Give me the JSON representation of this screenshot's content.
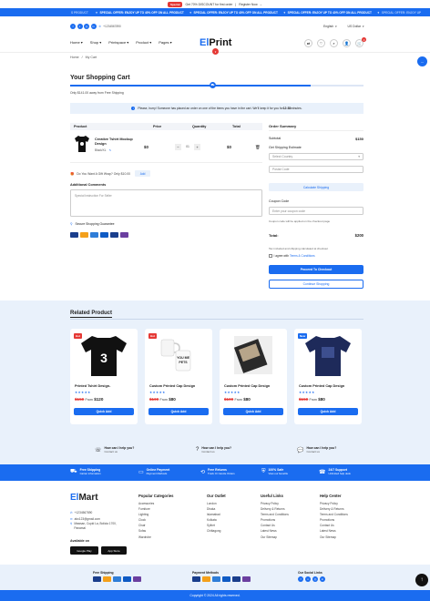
{
  "topbar": {
    "pill": "Special",
    "text": "Get 70% DISCOUNT for first order",
    "link": "Register Now"
  },
  "promo": {
    "items": [
      "SPECIAL OFFER: ENJOY UP TO 40% OFF ON ALL PRODUCT",
      "SPECIAL OFFER: ENJOY UP TO 40% OFF ON ALL PRODUCT",
      "SPECIAL OFFER: ENJOY UP TO 40% OFF ON ALL PRODUCT"
    ],
    "left_fragment": "S PRODUCT",
    "right_fragment": "SPECIAL OFFER: ENJOY UP"
  },
  "utility": {
    "phone": "+1234567890",
    "language": "English",
    "currency": "US Dollar"
  },
  "nav": {
    "items": [
      "Home",
      "Shop",
      "Printspace",
      "Product",
      "Pages"
    ],
    "logo_a": "El",
    "logo_b": "Print",
    "cart_count": "0"
  },
  "breadcrumb": {
    "home": "Home",
    "current": "My Cart"
  },
  "cart": {
    "title": "Your Shopping Cart",
    "shipping_progress": "Only $141.00 away from Free Shipping",
    "progress_pct": 82,
    "notice_pre": "Please, hurry! Someone has placed an order on one of the items you have in the cart. We'll keep it for you for ",
    "notice_time": "12:38",
    "notice_post": " minutes.",
    "columns": [
      "Product",
      "Price",
      "Quantity",
      "Total"
    ],
    "item": {
      "name": "Creative Tshirt Mockup Design",
      "variant": "Black/XL",
      "price": "$0",
      "qty": "01",
      "total": "$0"
    },
    "gift_text": "Do You Want A Gift Wrap? Only $10.00",
    "gift_btn": "Add",
    "comments_label": "Additional Comments",
    "comments_placeholder": "Special Instruction For Seller",
    "secure": "Secure Shopping Guarantee"
  },
  "summary": {
    "title": "Order Summary",
    "subtotal_label": "Subtotal",
    "subtotal": "$150",
    "shipping_label": "Get Shipping Estimate",
    "country": "Select Country",
    "postal": "Postal Code",
    "calc_btn": "Calculate Shipping",
    "coupon_label": "Coupon Code",
    "coupon_placeholder": "Enter your coupon code",
    "coupon_note": "Coupon code will be applied on the checkout page",
    "total_label": "Total:",
    "total": "$200",
    "tax_note": "Tax included and shipping calculated at checkout",
    "agree_pre": "I agree with ",
    "agree_link": "Terms & Conditions",
    "checkout_btn": "Proceed To Checkout",
    "continue_btn": "Continue Shopping"
  },
  "related": {
    "title": "Related Product",
    "products": [
      {
        "badge": "Hot",
        "name": "Printed Tshirt Design-",
        "old": "$150",
        "from": "From",
        "price": "$120",
        "btn": "Quick Add"
      },
      {
        "badge": "Hot",
        "name": "Custom Printed Cap Design",
        "old": "$100",
        "from": "From",
        "price": "$80",
        "btn": "Quick Add"
      },
      {
        "badge": "",
        "name": "Custom Printed Cap Design",
        "old": "$100",
        "from": "From",
        "price": "$80",
        "btn": "Quick Add"
      },
      {
        "badge": "New",
        "name": "Custom Printed Cap Design",
        "old": "$150",
        "from": "From",
        "price": "$80",
        "btn": "Quick Add"
      }
    ]
  },
  "help": [
    {
      "q": "How can I help you?",
      "a": "Contact us"
    },
    {
      "q": "How can I help you?",
      "a": "Contact us"
    },
    {
      "q": "How can I help you?",
      "a": "Contact us"
    }
  ],
  "features": [
    {
      "t": "Free Shipping",
      "s": "Carrier information"
    },
    {
      "t": "Online Payment",
      "s": "Payment Methods"
    },
    {
      "t": "Free Returns",
      "s": "Track Or Cancle Orders"
    },
    {
      "t": "100% Safe",
      "s": "View our benefits"
    },
    {
      "t": "24/7 Support",
      "s": "Unlimited help desk"
    }
  ],
  "footer": {
    "logo_a": "El",
    "logo_b": "Mart",
    "phone": "+1234567890",
    "email": "abc123@gmail.com",
    "address": "Mawsan, Cupid La, Bolicia 1700, Panamal",
    "available": "Available on",
    "gplay": "Google Play",
    "appstore": "App Store",
    "cols": [
      {
        "h": "Popular Categories",
        "items": [
          "Accessories",
          "Furniture",
          "Lighting",
          "Clock",
          "Chair",
          "Sofas",
          "Wardrobe"
        ]
      },
      {
        "h": "Our Outlet",
        "items": [
          "London",
          "Dhaka",
          "Islamabad",
          "Kolkata",
          "Sylhet",
          "Chittagong"
        ]
      },
      {
        "h": "Useful Links",
        "items": [
          "Privacy Policy",
          "Delivery & Returns",
          "Terms and Conditions",
          "Promotions",
          "Contact Us",
          "Latest News",
          "Our Sitemap"
        ]
      },
      {
        "h": "Help Center",
        "items": [
          "Privacy Policy",
          "Delivery & Returns",
          "Terms and Conditions",
          "Promotions",
          "Contact Us",
          "Latest News",
          "Our Sitemap"
        ]
      }
    ],
    "free_shipping": "Free Shipping",
    "payment_methods": "Payment Methods",
    "social": "Our Social Links",
    "copyright": "Copyright © 2024 All rights reserved."
  },
  "colors": {
    "accent": "#1a6cf0",
    "sale": "#e53935"
  }
}
